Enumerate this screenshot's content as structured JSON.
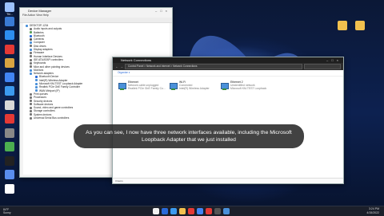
{
  "desktop": {
    "left_icons": [
      {
        "label": "Thi...",
        "color": "#9cc2ff"
      },
      {
        "label": "",
        "color": "#3a7bd5"
      },
      {
        "label": "",
        "color": "#2d8ef0"
      },
      {
        "label": "",
        "color": "#e53935"
      },
      {
        "label": "",
        "color": "#d9a441"
      },
      {
        "label": "",
        "color": "#4285f4"
      },
      {
        "label": "",
        "color": "#3c9aef"
      },
      {
        "label": "",
        "color": "#d9d9d9"
      },
      {
        "label": "",
        "color": "#e53935"
      },
      {
        "label": "",
        "color": "#888888"
      },
      {
        "label": "",
        "color": "#4caf50"
      },
      {
        "label": "",
        "color": "#222222"
      },
      {
        "label": "",
        "color": "#5a8dee"
      },
      {
        "label": "",
        "color": "#ffffff"
      }
    ],
    "right_icons": [
      {
        "label": "",
        "color": "#f2c14e"
      },
      {
        "label": "",
        "color": "#f2c14e"
      }
    ]
  },
  "device_manager": {
    "title": "Device Manager",
    "menu": "File  Action  View  Help",
    "tree": [
      {
        "text": "DESKTOP-1234",
        "color": "#4a90d9"
      },
      {
        "text": "Audio inputs and outputs",
        "color": "#7a7a7a"
      },
      {
        "text": "Batteries",
        "color": "#5aa05a"
      },
      {
        "text": "Bluetooth",
        "color": "#2a6ad8"
      },
      {
        "text": "Cameras",
        "color": "#555555"
      },
      {
        "text": "Computer",
        "color": "#4a90d9"
      },
      {
        "text": "Disk drives",
        "color": "#777777"
      },
      {
        "text": "Display adapters",
        "color": "#4a90d9"
      },
      {
        "text": "Firmware",
        "color": "#777777"
      },
      {
        "text": "Human Interface Devices",
        "color": "#777777"
      },
      {
        "text": "IDE ATA/ATAPI controllers",
        "color": "#777777"
      },
      {
        "text": "Keyboards",
        "color": "#777777"
      },
      {
        "text": "Mice and other pointing devices",
        "color": "#777777"
      },
      {
        "text": "Monitors",
        "color": "#4a90d9"
      },
      {
        "text": "Network adapters",
        "color": "#4a90d9"
      },
      {
        "text": "Bluetooth Device",
        "color": "#2a6ad8"
      },
      {
        "text": "Intel(R) Wireless Adapter",
        "color": "#4a90d9"
      },
      {
        "text": "Microsoft KM-TEST Loopback Adapter",
        "color": "#4a90d9"
      },
      {
        "text": "Realtek PCIe GbE Family Controller",
        "color": "#4a90d9"
      },
      {
        "text": "WAN Miniport (IP)",
        "color": "#4a90d9"
      },
      {
        "text": "Print queues",
        "color": "#777777"
      },
      {
        "text": "Processors",
        "color": "#777777"
      },
      {
        "text": "Security devices",
        "color": "#777777"
      },
      {
        "text": "Software devices",
        "color": "#777777"
      },
      {
        "text": "Sound, video and game controllers",
        "color": "#777777"
      },
      {
        "text": "Storage controllers",
        "color": "#777777"
      },
      {
        "text": "System devices",
        "color": "#777777"
      },
      {
        "text": "Universal Serial Bus controllers",
        "color": "#777777"
      }
    ]
  },
  "network_connections": {
    "title": "Network Connections",
    "path": "Control Panel  >  Network and Internet  >  Network Connections",
    "organize": "Organize ▾",
    "adapters": [
      {
        "name": "Ethernet",
        "status": "Network cable unplugged",
        "device": "Realtek PCIe GbE Family Co..."
      },
      {
        "name": "Wi-Fi",
        "status": "Connected",
        "device": "Intel(R) Wireless Adapter"
      },
      {
        "name": "Ethernet 2",
        "status": "Unidentified network",
        "device": "Microsoft KM-TEST Loopback"
      }
    ],
    "status_bar": "3 items"
  },
  "caption": "As you can see, I now have three network interfaces available, including the Microsoft Loopback Adapter that we just installed",
  "taskbar": {
    "weather_temp": "84°F",
    "weather_text": "Sunny",
    "time": "3:24 PM",
    "date": "4/15/2022",
    "apps": [
      "#f0f0f0",
      "#2a6ad8",
      "#3c9aef",
      "#f2c14e",
      "#e53935",
      "#4285f4",
      "#e53935",
      "#555555",
      "#4a90d9"
    ]
  }
}
